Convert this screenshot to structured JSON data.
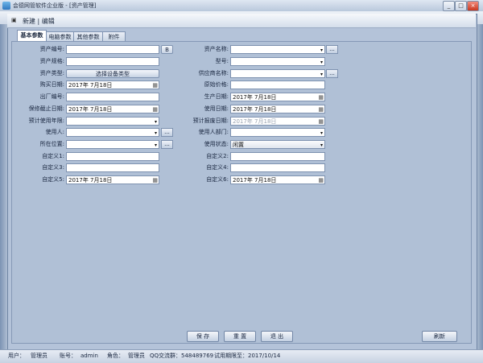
{
  "window": {
    "title": "会德网管软件企业版 - [资产管理]",
    "min": "_",
    "max": "□",
    "close": "×"
  },
  "dialog": {
    "title": "新建 | 编辑"
  },
  "tabs": [
    {
      "label": "基本参数",
      "active": true
    },
    {
      "label": "电脑参数",
      "active": false
    },
    {
      "label": "其他参数",
      "active": false
    },
    {
      "label": "附件",
      "active": false
    }
  ],
  "form_left": [
    {
      "label": "资产编号:",
      "value": "",
      "button": "B"
    },
    {
      "label": "资产规格:",
      "value": ""
    },
    {
      "label": "资产类型:",
      "value": "选择设备类型"
    },
    {
      "label": "购买日期:",
      "value": "2017年 7月18日"
    },
    {
      "label": "出厂编号:",
      "value": ""
    },
    {
      "label": "保修截止日期:",
      "value": "2017年 7月18日"
    },
    {
      "label": "预计使用年限:",
      "value": ""
    },
    {
      "label": "使用人:",
      "value": "",
      "button": "..."
    },
    {
      "label": "所在位置:",
      "value": "",
      "button": "..."
    },
    {
      "label": "自定义1:",
      "value": ""
    },
    {
      "label": "自定义3:",
      "value": ""
    },
    {
      "label": "自定义5:",
      "value": "2017年 7月18日"
    }
  ],
  "form_right": [
    {
      "label": "资产名称:",
      "value": "",
      "button": "..."
    },
    {
      "label": "型号:",
      "value": ""
    },
    {
      "label": "供应商名称:",
      "value": "",
      "button": "..."
    },
    {
      "label": "原始价格:",
      "value": ""
    },
    {
      "label": "生产日期:",
      "value": "2017年 7月18日"
    },
    {
      "label": "使用日期:",
      "value": "2017年 7月18日"
    },
    {
      "label": "预计报废日期:",
      "value": "2017年 7月18日"
    },
    {
      "label": "使用人部门:",
      "value": ""
    },
    {
      "label": "使用状态:",
      "value": "闲置"
    },
    {
      "label": "自定义2:",
      "value": ""
    },
    {
      "label": "自定义4:",
      "value": ""
    },
    {
      "label": "自定义6:",
      "value": "2017年 7月18日"
    }
  ],
  "buttons": {
    "save": "保 存",
    "reset": "重 置",
    "exit": "退 出",
    "refresh": "刷新"
  },
  "status": {
    "user_label": "用户：",
    "user": "管理员",
    "account_label": "账号：",
    "account": "admin",
    "role_label": "角色：",
    "role": "管理员",
    "qq": "QQ交流群：548489769",
    "trial": "试用期限至：2017/10/14"
  },
  "icons": {
    "dropdown": "▾",
    "calendar": "▦"
  }
}
